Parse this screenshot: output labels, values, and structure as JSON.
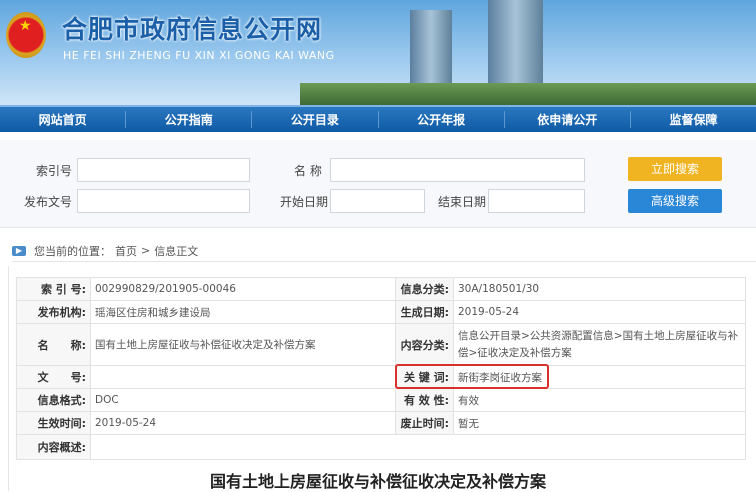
{
  "header": {
    "title": "合肥市政府信息公开网",
    "subtitle": "HE FEI SHI ZHENG FU XIN XI GONG KAI WANG"
  },
  "nav": [
    "网站首页",
    "公开指南",
    "公开目录",
    "公开年报",
    "依申请公开",
    "监督保障"
  ],
  "search": {
    "index_label": "索引号",
    "name_label": "名 称",
    "doc_no_label": "发布文号",
    "start_label": "开始日期",
    "end_label": "结束日期",
    "search_btn": "立即搜索",
    "advanced_btn": "高级搜索"
  },
  "breadcrumb": {
    "prefix": "您当前的位置：",
    "home": "首页",
    "sep": ">",
    "current": "信息正文"
  },
  "meta": {
    "index_k": "索 引 号:",
    "index_v": "002990829/201905-00046",
    "class_k": "信息分类:",
    "class_v": "30A/180501/30",
    "org_k": "发布机构:",
    "org_v": "瑶海区住房和城乡建设局",
    "date_k": "生成日期:",
    "date_v": "2019-05-24",
    "name_k": "名　　称:",
    "name_v": "国有土地上房屋征收与补偿征收决定及补偿方案",
    "cat_k": "内容分类:",
    "cat_v": "信息公开目录>公共资源配置信息>国有土地上房屋征收与补偿>征收决定及补偿方案",
    "docno_k": "文　　号:",
    "docno_v": "",
    "kw_k": "关 键 词:",
    "kw_v": "新街李岗征收方案",
    "fmt_k": "信息格式:",
    "fmt_v": "DOC",
    "valid_k": "有 效 性:",
    "valid_v": "有效",
    "eff_k": "生效时间:",
    "eff_v": "2019-05-24",
    "abol_k": "废止时间:",
    "abol_v": "暂无",
    "summary_k": "内容概述:",
    "summary_v": ""
  },
  "doc_title": "国有土地上房屋征收与补偿征收决定及补偿方案"
}
